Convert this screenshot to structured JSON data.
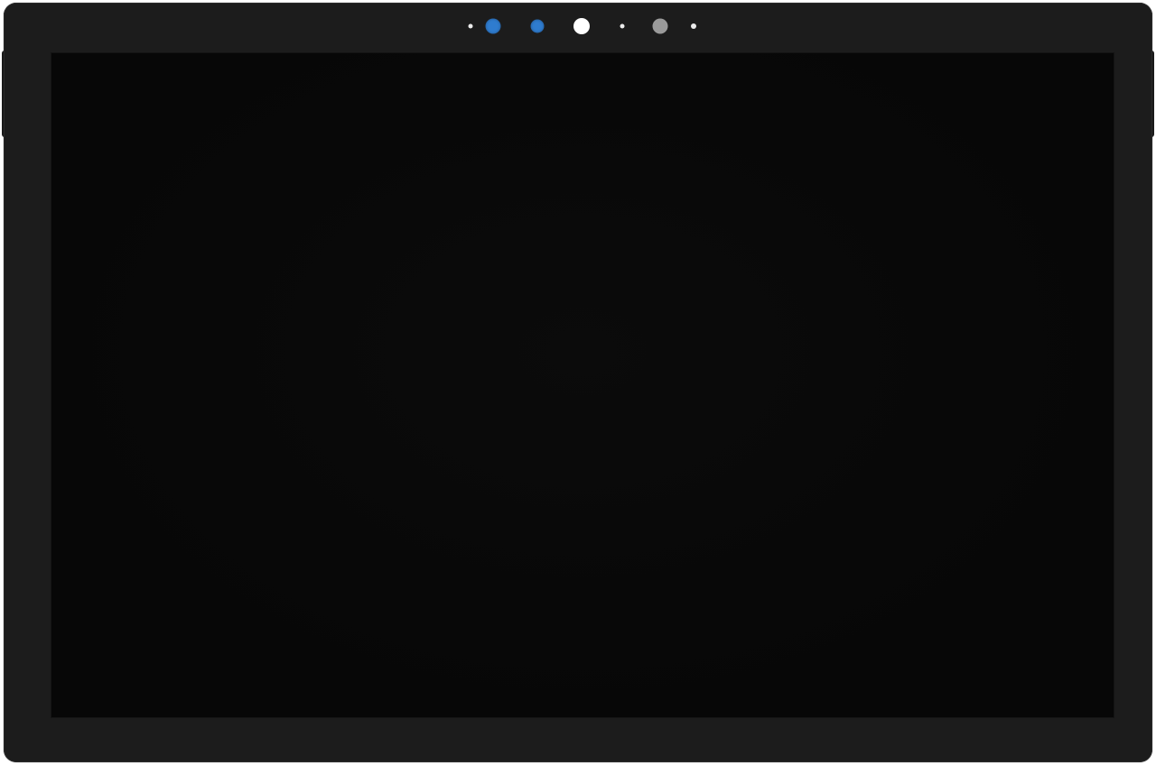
{
  "device": {
    "bezel_color": "#1c1c1c",
    "screen_color": "#070707",
    "sensors": [
      {
        "name": "sensor-dot-1-icon",
        "color": "#ececec",
        "kind": "pinhole"
      },
      {
        "name": "front-camera-icon",
        "color": "#2f7ccf",
        "kind": "lens"
      },
      {
        "name": "ir-camera-icon",
        "color": "#2f7ccf",
        "kind": "lens"
      },
      {
        "name": "ambient-light-sensor-icon",
        "color": "#ffffff",
        "kind": "sensor"
      },
      {
        "name": "sensor-dot-2-icon",
        "color": "#ececec",
        "kind": "pinhole"
      },
      {
        "name": "ir-emitter-icon",
        "color": "#9a9a9a",
        "kind": "sensor"
      },
      {
        "name": "sensor-dot-3-icon",
        "color": "#ececec",
        "kind": "pinhole"
      }
    ]
  }
}
